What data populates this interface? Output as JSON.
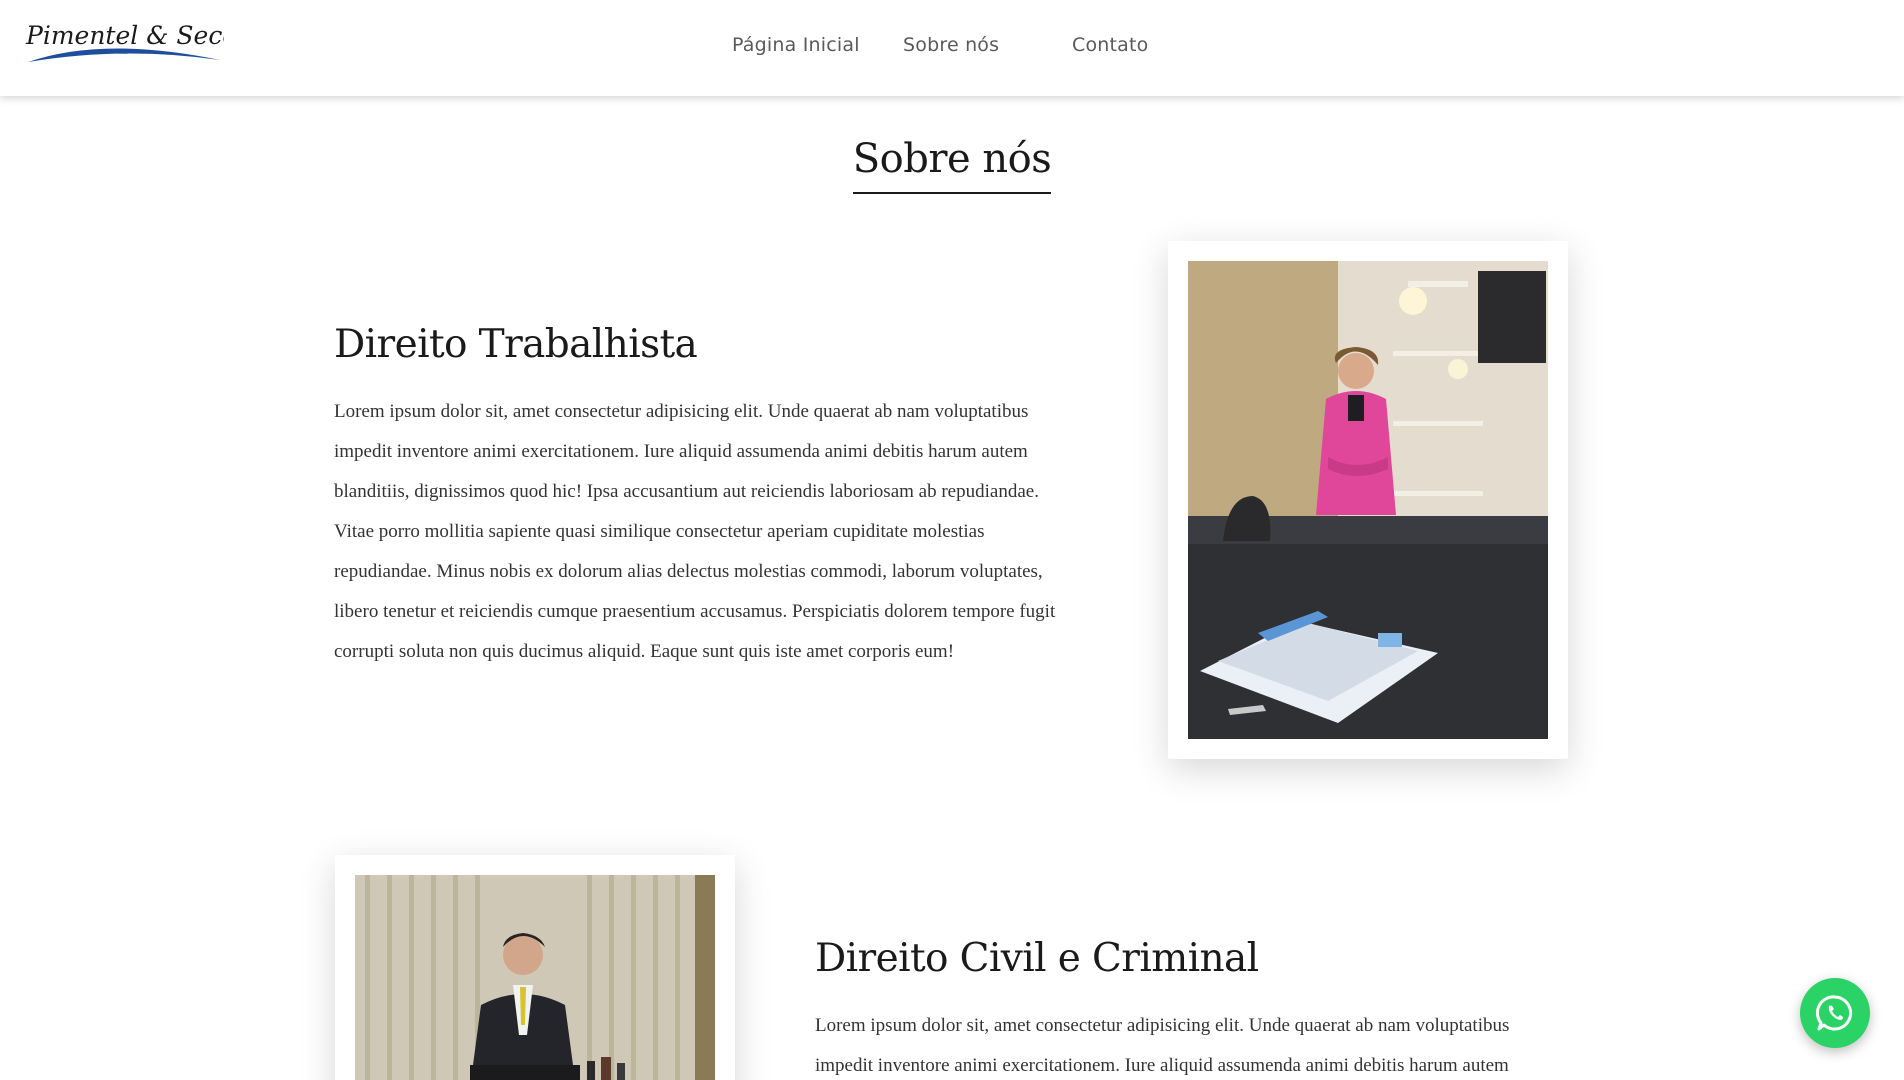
{
  "header": {
    "logo_text": "Pimentel & Secco",
    "nav": {
      "home": "Página Inicial",
      "about": "Sobre nós",
      "contact": "Contato"
    }
  },
  "main": {
    "section_title": "Sobre nós",
    "blocks": [
      {
        "heading": "Direito Trabalhista",
        "text": "Lorem ipsum dolor sit, amet consectetur adipisicing elit. Unde quaerat ab nam voluptatibus impedit inventore animi exercitationem. Iure aliquid assumenda animi debitis harum autem blanditiis, dignissimos quod hic! Ipsa accusantium aut reiciendis laboriosam ab repudiandae. Vitae porro mollitia sapiente quasi similique consectetur aperiam cupiditate molestias repudiandae. Minus nobis ex dolorum alias delectus molestias commodi, laborum voluptates, libero tenetur et reiciendis cumque praesentium accusamus. Perspiciatis dolorem tempore fugit corrupti soluta non quis ducimus aliquid. Eaque sunt quis iste amet corporis eum!"
      },
      {
        "heading": "Direito Civil e Criminal",
        "text": "Lorem ipsum dolor sit, amet consectetur adipisicing elit. Unde quaerat ab nam voluptatibus impedit inventore animi exercitationem. Iure aliquid assumenda animi debitis harum autem"
      }
    ]
  },
  "whatsapp": {
    "icon": "whatsapp-icon",
    "color": "#2bd366"
  },
  "colors": {
    "logo_swoosh": "#1f4e9c",
    "nav_text": "#5a5a5a",
    "heading": "#1a1a1a"
  }
}
